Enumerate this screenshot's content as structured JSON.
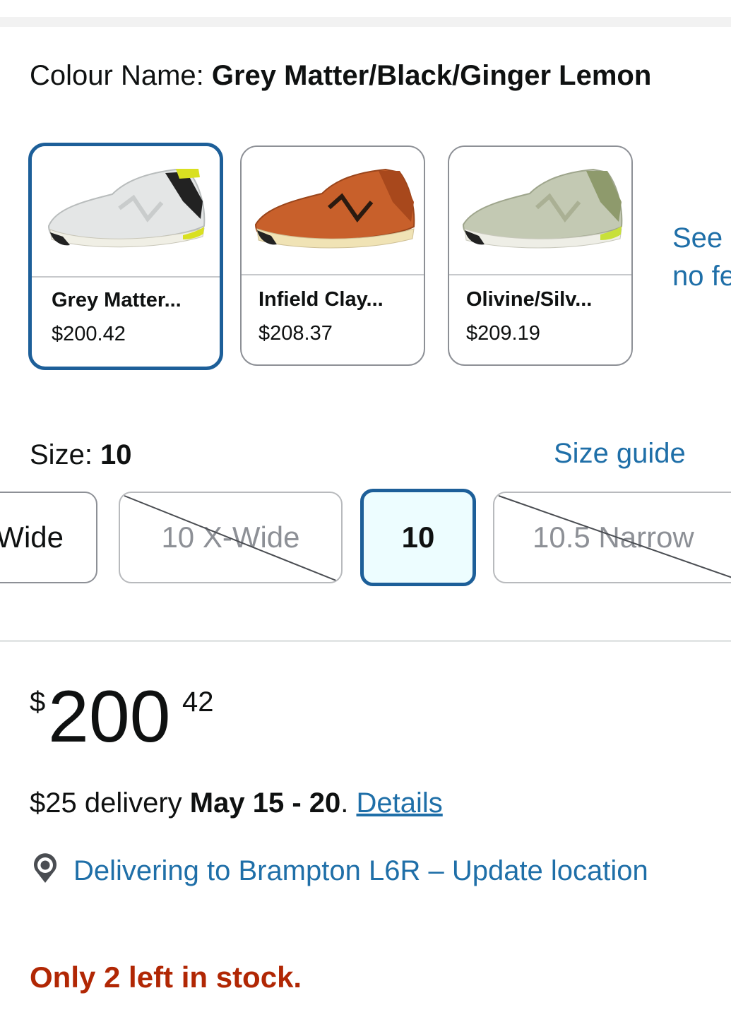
{
  "colour": {
    "label": "Colour Name: ",
    "value": "Grey Matter/Black/Ginger Lemon"
  },
  "swatches": [
    {
      "name": "Grey Matter...",
      "price": "$200.42",
      "selected": true,
      "body_color": "#e4e6e6",
      "accent_color": "#d9e021"
    },
    {
      "name": "Infield Clay...",
      "price": "$208.37",
      "selected": false,
      "body_color": "#c8602b",
      "accent_color": "#f0e3b5"
    },
    {
      "name": "Olivine/Silv...",
      "price": "$209.19",
      "selected": false,
      "body_color": "#c3c9b3",
      "accent_color": "#c8e03a"
    }
  ],
  "see_more": {
    "line1": "See",
    "line2": "no fe"
  },
  "size": {
    "label": "Size: ",
    "value": "10",
    "guide_label": "Size guide",
    "options": [
      {
        "label": "Wide",
        "available": true,
        "selected": false
      },
      {
        "label": "10 X-Wide",
        "available": false,
        "selected": false
      },
      {
        "label": "10",
        "available": true,
        "selected": true
      },
      {
        "label": "10.5 Narrow",
        "available": false,
        "selected": false
      }
    ]
  },
  "price": {
    "symbol": "$",
    "whole": "200",
    "fraction": "42"
  },
  "delivery": {
    "prefix": "$25 delivery ",
    "dates": "May 15 - 20",
    "suffix": ". ",
    "details_link": "Details"
  },
  "location": {
    "text": "Delivering to Brampton L6R – Update location"
  },
  "stock": {
    "text": "Only 2 left in stock."
  },
  "colors": {
    "link": "#1f6fa8",
    "selected_border": "#1d5f99",
    "stock_red": "#b12704"
  }
}
